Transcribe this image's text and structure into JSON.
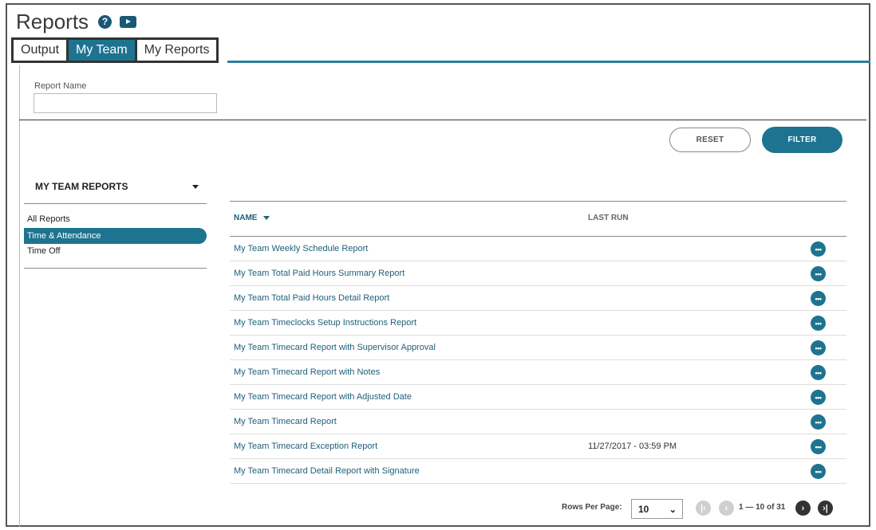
{
  "header": {
    "title": "Reports",
    "help_icon": "question-circle-icon",
    "video_icon": "video-play-icon"
  },
  "tabs": [
    {
      "label": "Output",
      "active": false
    },
    {
      "label": "My Team",
      "active": true
    },
    {
      "label": "My Reports",
      "active": false
    }
  ],
  "filter": {
    "report_name_label": "Report Name",
    "report_name_value": "",
    "reset_label": "RESET",
    "filter_label": "FILTER"
  },
  "sidebar": {
    "heading": "MY TEAM REPORTS",
    "items": [
      {
        "label": "All Reports",
        "active": false
      },
      {
        "label": "Time & Attendance",
        "active": true
      },
      {
        "label": "Time Off",
        "active": false
      }
    ]
  },
  "table": {
    "columns": {
      "name": "NAME",
      "last_run": "LAST RUN"
    },
    "rows": [
      {
        "name": "My Team Weekly Schedule Report",
        "last_run": ""
      },
      {
        "name": "My Team Total Paid Hours Summary Report",
        "last_run": ""
      },
      {
        "name": "My Team Total Paid Hours Detail Report",
        "last_run": ""
      },
      {
        "name": "My Team Timeclocks Setup Instructions Report",
        "last_run": ""
      },
      {
        "name": "My Team Timecard Report with Supervisor Approval",
        "last_run": ""
      },
      {
        "name": "My Team Timecard Report with Notes",
        "last_run": ""
      },
      {
        "name": "My Team Timecard Report with Adjusted Date",
        "last_run": ""
      },
      {
        "name": "My Team Timecard Report",
        "last_run": ""
      },
      {
        "name": "My Team Timecard Exception Report",
        "last_run": "11/27/2017 - 03:59 PM"
      },
      {
        "name": "My Team Timecard Detail Report with Signature",
        "last_run": ""
      }
    ],
    "more_icon": "ellipsis-icon"
  },
  "pager": {
    "rows_label": "Rows Per Page:",
    "rows_value": "10",
    "count": "1 — 10 of 31"
  },
  "colors": {
    "accent": "#1e7490",
    "link": "#1e5f7a"
  }
}
